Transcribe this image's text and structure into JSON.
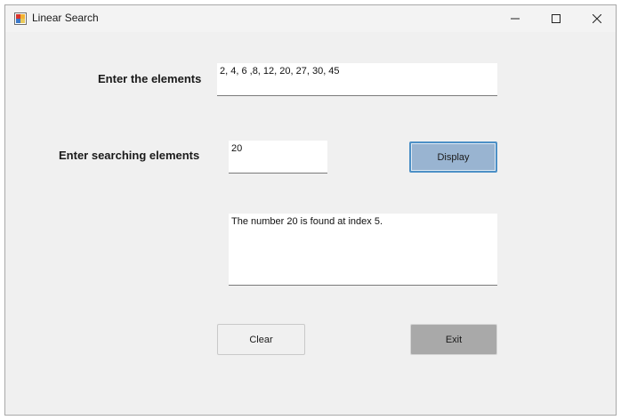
{
  "window": {
    "title": "Linear Search"
  },
  "form": {
    "elements_label": "Enter the elements",
    "elements_value": "2, 4, 6 ,8, 12, 20, 27, 30, 45",
    "search_label": "Enter searching elements",
    "search_value": "20",
    "result_text": "The number 20 is found at index 5."
  },
  "buttons": {
    "display": "Display",
    "clear": "Clear",
    "exit": "Exit"
  },
  "icons": {
    "app": "app-form-icon",
    "minimize": "minimize-icon",
    "maximize": "maximize-icon",
    "close": "close-icon"
  },
  "colors": {
    "display_button": "#99b4d1",
    "exit_button": "#a9a9a9",
    "window_background": "#f0f0f0"
  }
}
